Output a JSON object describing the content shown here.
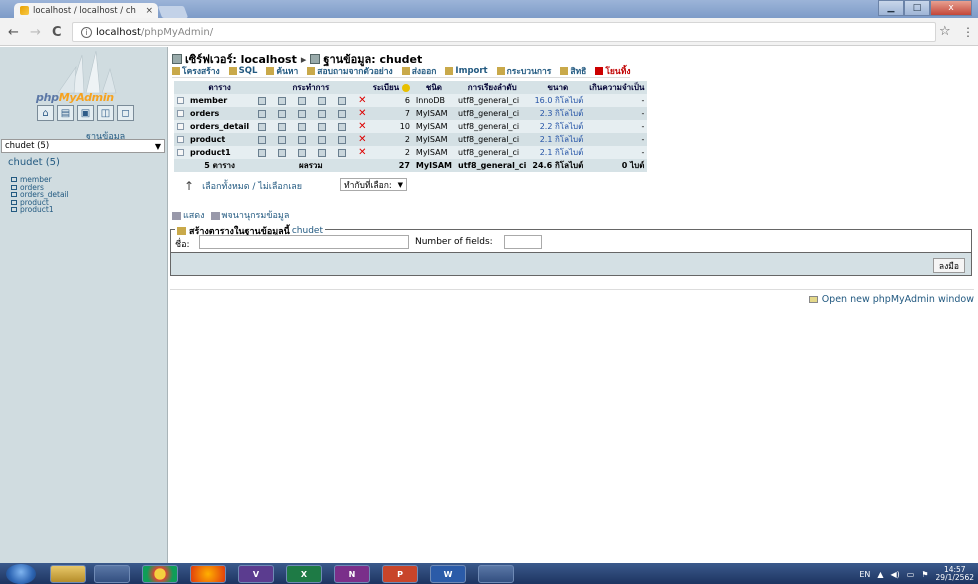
{
  "browser": {
    "tab_title": "localhost / localhost / ch",
    "tab_close": "×",
    "url_host": "localhost",
    "url_path": "/phpMyAdmin/",
    "back": "←",
    "forward": "→",
    "reload": "C",
    "star": "☆",
    "menu": "⋮"
  },
  "window": {
    "minimize": "▁",
    "maximize": "□",
    "close": "x"
  },
  "sidebar": {
    "logo_part1": "php",
    "logo_part2": "MyAdmin",
    "database_label": "ฐานข้อมูล",
    "database_select": "chudet (5)",
    "db_title": "chudet (5)",
    "tables": [
      "member",
      "orders",
      "orders_detail",
      "product",
      "product1"
    ]
  },
  "breadcrumb": {
    "server": "เซิร์ฟเวอร์: localhost",
    "separator": "▸",
    "database": "ฐานข้อมูล: chudet"
  },
  "tabs": [
    {
      "label": "โครงสร้าง"
    },
    {
      "label": "SQL"
    },
    {
      "label": "ค้นหา"
    },
    {
      "label": "สอบถามจากตัวอย่าง"
    },
    {
      "label": "ส่งออก"
    },
    {
      "label": "Import"
    },
    {
      "label": "กระบวนการ"
    },
    {
      "label": "สิทธิ"
    },
    {
      "label": "โยนทิ้ง"
    }
  ],
  "table_headers": {
    "table": "ตาราง",
    "action": "กระทำการ",
    "records": "ระเบียน",
    "type": "ชนิด",
    "collation": "การเรียงลำดับ",
    "size": "ขนาด",
    "overhead": "เกินความจำเป็น"
  },
  "rows": [
    {
      "name": "member",
      "records": "6",
      "type": "InnoDB",
      "collation": "utf8_general_ci",
      "size": "16.0 กิโลไบต์",
      "overhead": "-"
    },
    {
      "name": "orders",
      "records": "7",
      "type": "MyISAM",
      "collation": "utf8_general_ci",
      "size": "2.3 กิโลไบต์",
      "overhead": "-"
    },
    {
      "name": "orders_detail",
      "records": "10",
      "type": "MyISAM",
      "collation": "utf8_general_ci",
      "size": "2.2 กิโลไบต์",
      "overhead": "-"
    },
    {
      "name": "product",
      "records": "2",
      "type": "MyISAM",
      "collation": "utf8_general_ci",
      "size": "2.1 กิโลไบต์",
      "overhead": "-"
    },
    {
      "name": "product1",
      "records": "2",
      "type": "MyISAM",
      "collation": "utf8_general_ci",
      "size": "2.1 กิโลไบต์",
      "overhead": "-"
    }
  ],
  "totals": {
    "tables": "5 ตาราง",
    "sum_label": "ผลรวม",
    "records": "27",
    "type": "MyISAM",
    "collation": "utf8_general_ci",
    "size": "24.6 กิโลไบต์",
    "overhead": "0 ไบต์"
  },
  "check_all": "เลือกทั้งหมด / ไม่เลือกเลย",
  "with_selected": "ทำกับที่เลือก:",
  "print_view": "แสดง",
  "data_dictionary": "พจนานุกรมข้อมูล",
  "create_table": {
    "legend": "สร้างตารางในฐานข้อมูลนี้",
    "db_name": "chudet",
    "name_label": "ชื่อ:",
    "fields_label": "Number of fields:",
    "go_button": "ลงมือ"
  },
  "open_new_window": "Open new phpMyAdmin window",
  "taskbar": {
    "apps": [
      "",
      "",
      "",
      "",
      "",
      "V",
      "X",
      "N",
      "P",
      "W",
      ""
    ],
    "lang": "EN",
    "time": "14:57",
    "date": "29/1/2562"
  },
  "colors": {
    "sidebar_bg": "#d0dce0",
    "link": "#235a81",
    "row_odd": "#e6eef1",
    "row_even": "#d4e0e4",
    "delete_red": "#dd0000"
  }
}
